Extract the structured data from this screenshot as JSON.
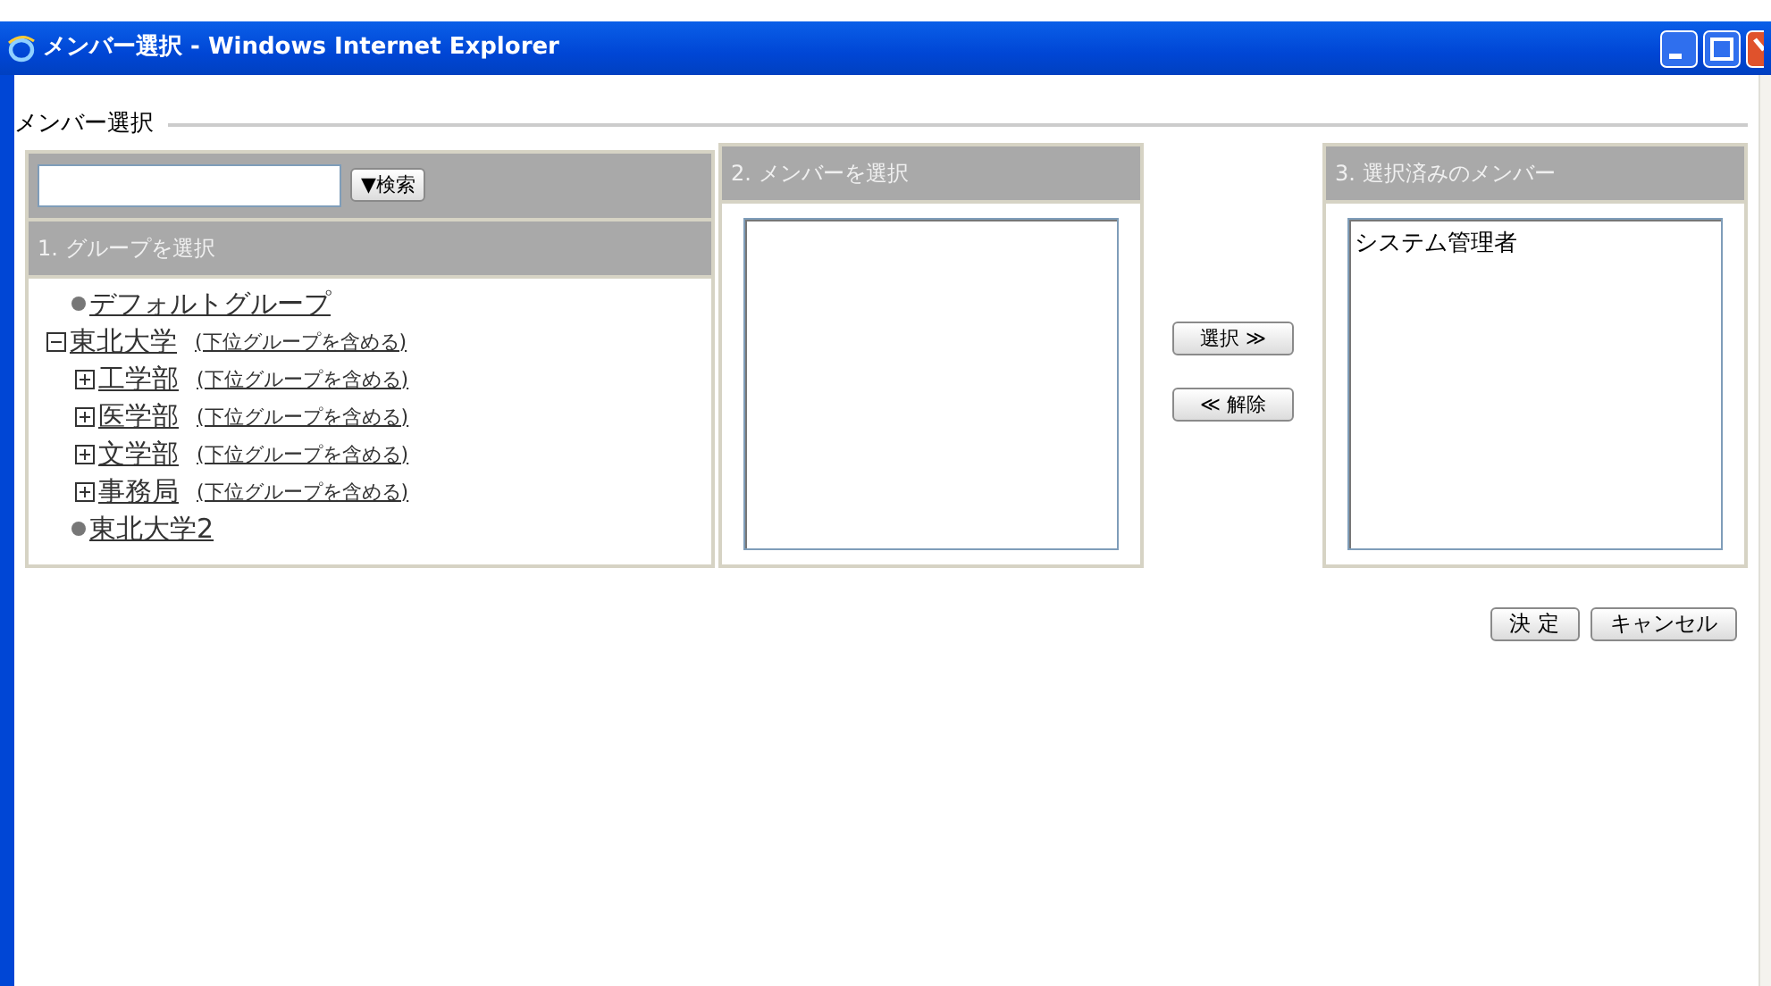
{
  "window": {
    "title": "メンバー選択 - Windows Internet Explorer"
  },
  "legend": "メンバー選択",
  "search": {
    "button": "▼検索"
  },
  "group_panel": {
    "title": "1. グループを選択",
    "tree": [
      {
        "kind": "leaf",
        "label": "デフォルトグループ"
      },
      {
        "kind": "branch",
        "label": "東北大学",
        "expanded": true,
        "include_link": "(下位グループを含める)",
        "children": [
          {
            "kind": "branch",
            "label": "工学部",
            "expanded": false,
            "include_link": "(下位グループを含める)"
          },
          {
            "kind": "branch",
            "label": "医学部",
            "expanded": false,
            "include_link": "(下位グループを含める)"
          },
          {
            "kind": "branch",
            "label": "文学部",
            "expanded": false,
            "include_link": "(下位グループを含める)"
          },
          {
            "kind": "branch",
            "label": "事務局",
            "expanded": false,
            "include_link": "(下位グループを含める)"
          }
        ]
      },
      {
        "kind": "leaf",
        "label": "東北大学2"
      }
    ]
  },
  "member_panel": {
    "title": "2. メンバーを選択"
  },
  "move_buttons": [
    {
      "label": "選択 ≫"
    },
    {
      "label": "≪ 解除"
    }
  ],
  "selected_panel": {
    "title": "3. 選択済みのメンバー",
    "items": [
      "システム管理者"
    ]
  },
  "footer_buttons": [
    {
      "label": "決 定"
    },
    {
      "label": "キャンセル"
    }
  ]
}
